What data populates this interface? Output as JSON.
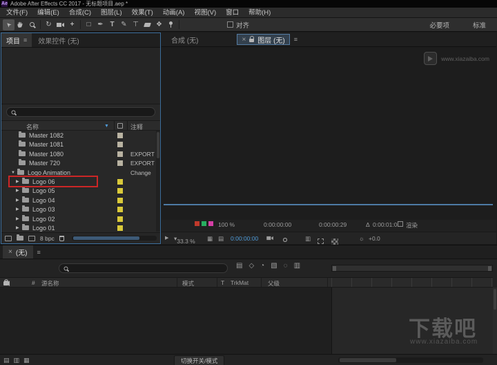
{
  "colors": {
    "accent_blue": "#4f9bd8",
    "panel_focus_blue": "#3c6e9c",
    "annotation_red": "#cc2626",
    "label_yellow": "#d9c93a",
    "label_gray": "#b9b3a2",
    "scroll_thumb_blue": "#3d5a77",
    "viewer_scrollbar_blue": "#4d7aa5"
  },
  "title_bar": {
    "app_icon_text": "Ae",
    "title": "Adobe After Effects CC 2017 - 无标题项目.aep *"
  },
  "menu_bar": {
    "items": [
      "文件(F)",
      "编辑(E)",
      "合成(C)",
      "图层(L)",
      "效果(T)",
      "动画(A)",
      "视图(V)",
      "窗口",
      "帮助(H)"
    ]
  },
  "toolbar": {
    "align_label": "对齐",
    "workspaces": [
      "必要项",
      "标准"
    ]
  },
  "project_panel": {
    "tab_project": "项目",
    "tab_effects": "效果控件 (无)",
    "search_placeholder": "",
    "col_name": "名称",
    "col_comment": "注释",
    "bit_depth": "8 bpc",
    "items": [
      {
        "label": "Master 1082",
        "comment": ""
      },
      {
        "label": "Master 1081",
        "comment": ""
      },
      {
        "label": "Master 1080",
        "comment": "EXPORT"
      },
      {
        "label": "Master 720",
        "comment": "EXPORT"
      },
      {
        "label": "Logo Animation",
        "comment": "Change"
      },
      {
        "label": "Logo 06",
        "comment": ""
      },
      {
        "label": "Logo 05",
        "comment": ""
      },
      {
        "label": "Logo 04",
        "comment": ""
      },
      {
        "label": "Logo 03",
        "comment": ""
      },
      {
        "label": "Logo 02",
        "comment": ""
      },
      {
        "label": "Logo 01",
        "comment": ""
      }
    ]
  },
  "viewer_panel": {
    "tab_composition": "合成 (无)",
    "tab_layer": "图层 (无)",
    "info": {
      "opacity": "100 %",
      "time_in": "0:00:00:00",
      "time_out": "0:00:00:29",
      "duration": "0:00:01:00",
      "render_label": "渲染"
    },
    "controls": {
      "zoom": "33.3 %",
      "timecode": "0:00:00:00",
      "exposure": "+0.0"
    }
  },
  "timeline_panel": {
    "tab_label": "(无)",
    "search_placeholder": "",
    "col_hash": "#",
    "col_source": "源名称",
    "col_mode": "模式",
    "col_t": "T",
    "col_trkmat": "TrkMat",
    "col_parent": "父级",
    "toggle_button": "切换开关/模式"
  },
  "watermarks": {
    "viewer_logo_text": "www.xiazaiba.com",
    "big_text": "下载吧",
    "big_subtext": "www.xiazaiba.com"
  }
}
